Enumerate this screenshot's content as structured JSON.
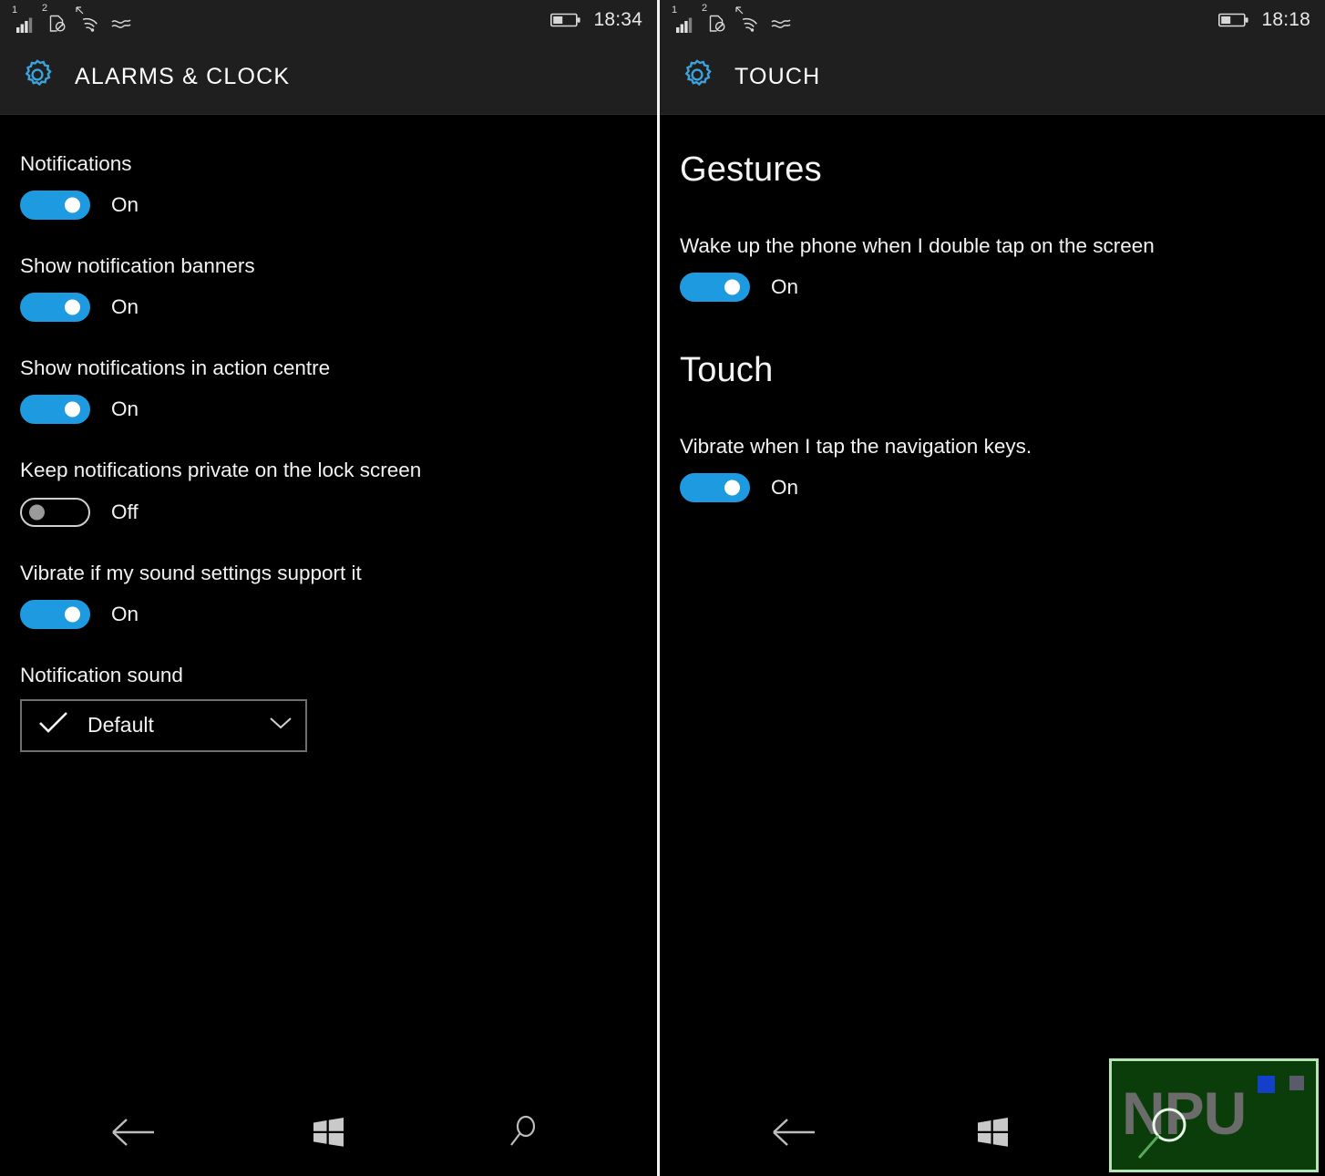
{
  "screens": [
    {
      "id": "alarms-clock",
      "statusbar": {
        "sim1_label": "1",
        "sim2_label": "2",
        "icons": [
          "signal-bars-icon",
          "no-sim-icon",
          "wifi-icon",
          "vibrate-icon"
        ],
        "battery_icon": "battery-icon",
        "time": "18:34"
      },
      "header": {
        "icon": "settings-gear-icon",
        "title": "ALARMS & CLOCK"
      },
      "settings": [
        {
          "label": "Notifications",
          "state": "On",
          "on": true
        },
        {
          "label": "Show notification banners",
          "state": "On",
          "on": true
        },
        {
          "label": "Show notifications in action centre",
          "state": "On",
          "on": true
        },
        {
          "label": "Keep notifications private on the lock screen",
          "state": "Off",
          "on": false
        },
        {
          "label": "Vibrate if my sound settings support it",
          "state": "On",
          "on": true
        }
      ],
      "dropdown": {
        "label": "Notification sound",
        "value": "Default",
        "check_icon": "check-icon",
        "chevron_icon": "chevron-down-icon"
      },
      "navbar": {
        "back": "back-arrow-icon",
        "home": "windows-start-icon",
        "search": "search-icon"
      }
    },
    {
      "id": "touch",
      "statusbar": {
        "sim1_label": "1",
        "sim2_label": "2",
        "icons": [
          "signal-bars-icon",
          "no-sim-icon",
          "wifi-icon",
          "vibrate-icon"
        ],
        "battery_icon": "battery-icon",
        "time": "18:18"
      },
      "header": {
        "icon": "settings-gear-icon",
        "title": "TOUCH"
      },
      "sections": [
        {
          "heading": "Gestures",
          "settings": [
            {
              "label": "Wake up the phone when I double tap on the screen",
              "state": "On",
              "on": true
            }
          ]
        },
        {
          "heading": "Touch",
          "settings": [
            {
              "label": "Vibrate when I tap the navigation keys.",
              "state": "On",
              "on": true
            }
          ]
        }
      ],
      "navbar": {
        "back": "back-arrow-icon",
        "home": "windows-start-icon",
        "search": "search-icon"
      }
    }
  ],
  "watermark": {
    "text": "NPU",
    "icon": "magnifier-icon"
  },
  "colors": {
    "accent_blue": "#1e9ae0",
    "gear_blue": "#2f9fd8",
    "header_bg": "#1f1f1f",
    "body_bg": "#000000",
    "text": "#f2f2f2",
    "watermark_bg": "#0a3d0a",
    "watermark_border": "#b3e6b3"
  }
}
